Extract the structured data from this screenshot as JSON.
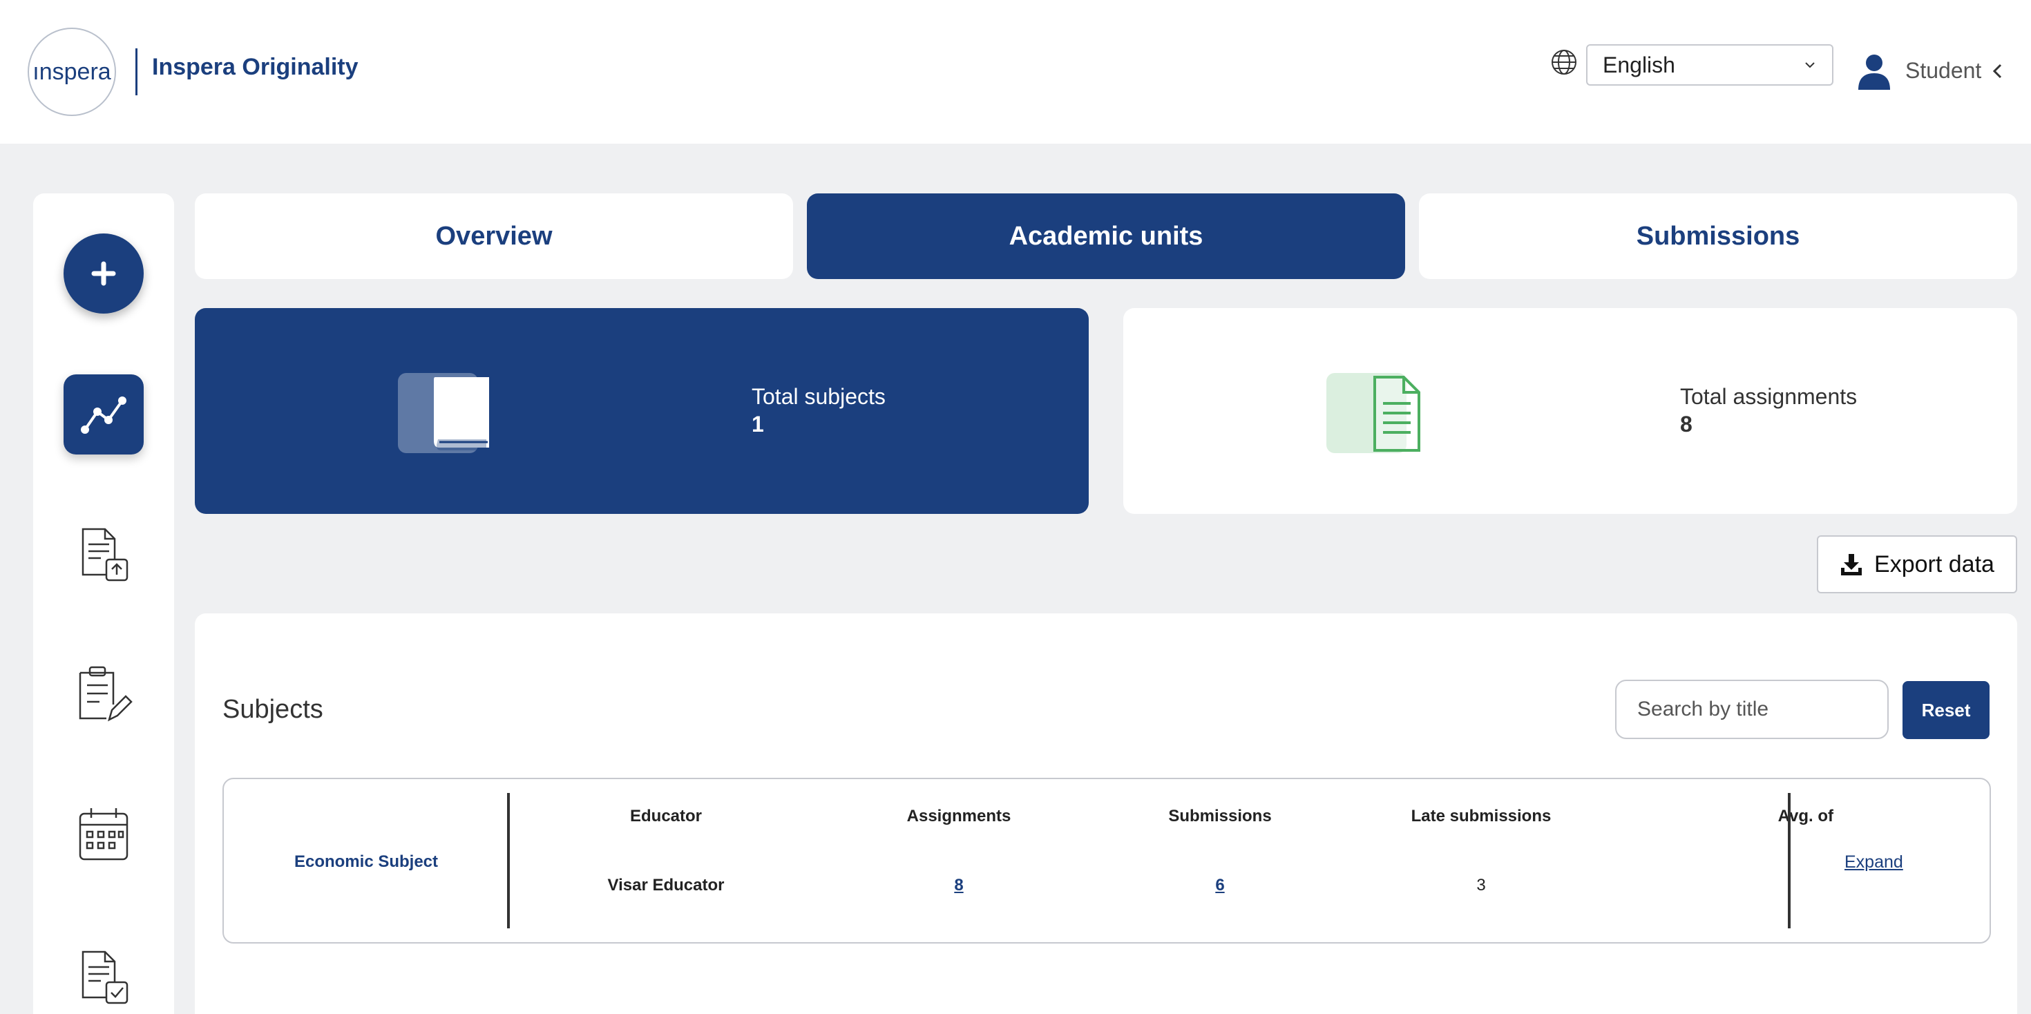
{
  "header": {
    "logo_text": "ınspera",
    "brand_name": "Inspera Originality",
    "language": "English",
    "user_role": "Student"
  },
  "sidebar": {
    "items": [
      {
        "name": "new-button",
        "icon": "plus-icon"
      },
      {
        "name": "analytics",
        "icon": "chart-line-icon"
      },
      {
        "name": "upload-document",
        "icon": "document-upload-icon"
      },
      {
        "name": "assignments",
        "icon": "clipboard-edit-icon"
      },
      {
        "name": "calendar",
        "icon": "calendar-icon"
      },
      {
        "name": "reviewed-documents",
        "icon": "document-check-icon"
      }
    ]
  },
  "tabs": [
    {
      "label": "Overview",
      "active": false
    },
    {
      "label": "Academic units",
      "active": true
    },
    {
      "label": "Submissions",
      "active": false
    }
  ],
  "stats": {
    "subjects": {
      "label": "Total subjects",
      "value": "1"
    },
    "assignments": {
      "label": "Total assignments",
      "value": "8"
    }
  },
  "export": {
    "label": "Export data"
  },
  "subjects_panel": {
    "title": "Subjects",
    "search_placeholder": "Search by title",
    "reset_label": "Reset",
    "columns": [
      "Educator",
      "Assignments",
      "Submissions",
      "Late submissions",
      "Avg. of"
    ],
    "rows": [
      {
        "subject": "Economic Subject",
        "educator": "Visar Educator",
        "assignments": "8",
        "submissions": "6",
        "late_submissions": "3",
        "expand_label": "Expand"
      }
    ]
  },
  "colors": {
    "primary": "#1b3f7e",
    "background": "#eff0f2",
    "success_green": "#4caf60"
  }
}
